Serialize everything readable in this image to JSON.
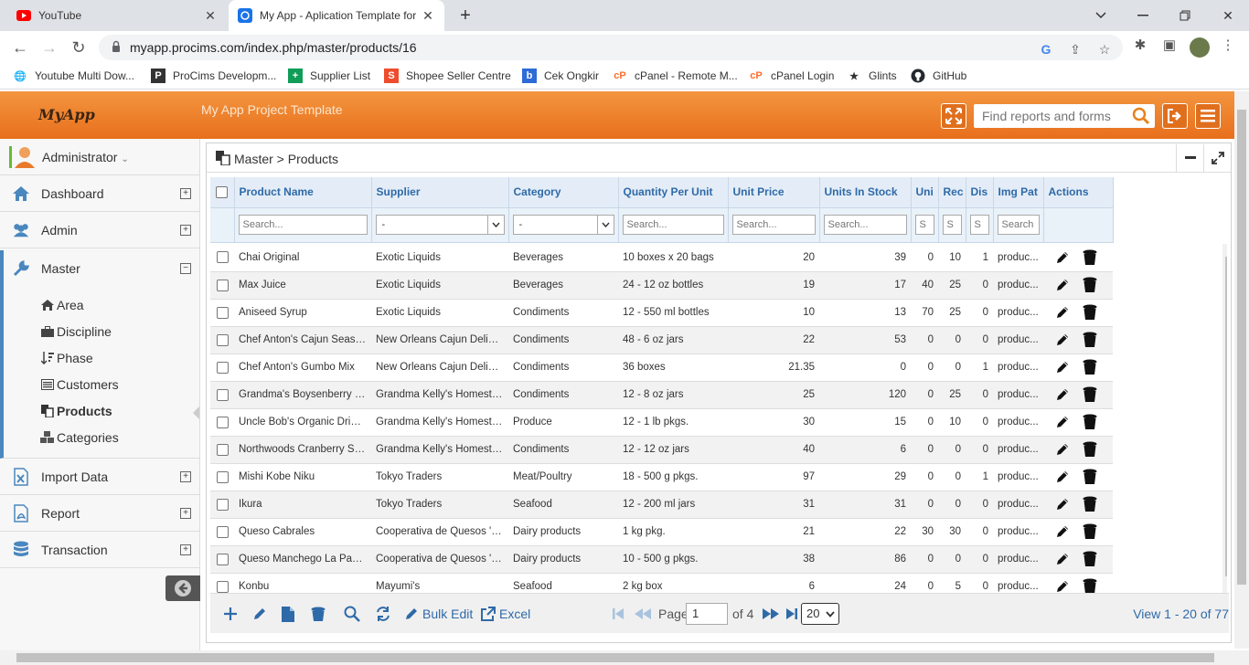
{
  "browser": {
    "tabs": [
      {
        "title": "YouTube",
        "active": false
      },
      {
        "title": "My App - Aplication Template for",
        "active": true
      }
    ],
    "url": "myapp.procims.com/index.php/master/products/16",
    "bookmarks": [
      {
        "label": "Youtube Multi Dow..."
      },
      {
        "label": "ProCims Developm..."
      },
      {
        "label": "Supplier List"
      },
      {
        "label": "Shopee Seller Centre"
      },
      {
        "label": "Cek Ongkir"
      },
      {
        "label": "cPanel - Remote M..."
      },
      {
        "label": "cPanel Login"
      },
      {
        "label": "Glints"
      },
      {
        "label": "GitHub"
      }
    ]
  },
  "header": {
    "logo": "MyApp",
    "title": "My App Project Template",
    "search_placeholder": "Find reports and forms"
  },
  "sidebar": {
    "user": "Administrator",
    "items": [
      {
        "label": "Dashboard",
        "toggle": "+"
      },
      {
        "label": "Admin",
        "toggle": "+"
      },
      {
        "label": "Master",
        "toggle": "−"
      },
      {
        "label": "Import Data",
        "toggle": "+"
      },
      {
        "label": "Report",
        "toggle": "+"
      },
      {
        "label": "Transaction",
        "toggle": "+"
      }
    ],
    "master_sub": [
      {
        "label": "Area"
      },
      {
        "label": "Discipline"
      },
      {
        "label": "Phase"
      },
      {
        "label": "Customers"
      },
      {
        "label": "Products"
      },
      {
        "label": "Categories"
      }
    ]
  },
  "panel": {
    "breadcrumb": "Master > Products"
  },
  "grid": {
    "columns": [
      "Product Name",
      "Supplier",
      "Category",
      "Quantity Per Unit",
      "Unit Price",
      "Units In Stock",
      "Uni",
      "Rec",
      "Dis",
      "Img Pat",
      "Actions"
    ],
    "filters": {
      "search": "Search...",
      "select": "-",
      "short": "S",
      "img": "Search"
    },
    "rows": [
      {
        "name": "Chai Original",
        "supplier": "Exotic Liquids",
        "category": "Beverages",
        "qpu": "10 boxes x 20 bags",
        "price": "20",
        "stock": "39",
        "uni": "0",
        "rec": "10",
        "dis": "1",
        "img": "produc..."
      },
      {
        "name": "Max Juice",
        "supplier": "Exotic Liquids",
        "category": "Beverages",
        "qpu": "24 - 12 oz bottles",
        "price": "19",
        "stock": "17",
        "uni": "40",
        "rec": "25",
        "dis": "0",
        "img": "produc..."
      },
      {
        "name": "Aniseed Syrup",
        "supplier": "Exotic Liquids",
        "category": "Condiments",
        "qpu": "12 - 550 ml bottles",
        "price": "10",
        "stock": "13",
        "uni": "70",
        "rec": "25",
        "dis": "0",
        "img": "produc..."
      },
      {
        "name": "Chef Anton's Cajun Season...",
        "supplier": "New Orleans Cajun Delights",
        "category": "Condiments",
        "qpu": "48 - 6 oz jars",
        "price": "22",
        "stock": "53",
        "uni": "0",
        "rec": "0",
        "dis": "0",
        "img": "produc..."
      },
      {
        "name": "Chef Anton's Gumbo Mix",
        "supplier": "New Orleans Cajun Delights",
        "category": "Condiments",
        "qpu": "36 boxes",
        "price": "21.35",
        "stock": "0",
        "uni": "0",
        "rec": "0",
        "dis": "1",
        "img": "produc..."
      },
      {
        "name": "Grandma's Boysenberry Sp...",
        "supplier": "Grandma Kelly's Homestead",
        "category": "Condiments",
        "qpu": "12 - 8 oz jars",
        "price": "25",
        "stock": "120",
        "uni": "0",
        "rec": "25",
        "dis": "0",
        "img": "produc..."
      },
      {
        "name": "Uncle Bob's Organic Dried ...",
        "supplier": "Grandma Kelly's Homestead",
        "category": "Produce",
        "qpu": "12 - 1 lb pkgs.",
        "price": "30",
        "stock": "15",
        "uni": "0",
        "rec": "10",
        "dis": "0",
        "img": "produc..."
      },
      {
        "name": "Northwoods Cranberry Sau...",
        "supplier": "Grandma Kelly's Homestead",
        "category": "Condiments",
        "qpu": "12 - 12 oz jars",
        "price": "40",
        "stock": "6",
        "uni": "0",
        "rec": "0",
        "dis": "0",
        "img": "produc..."
      },
      {
        "name": "Mishi Kobe Niku",
        "supplier": "Tokyo Traders",
        "category": "Meat/Poultry",
        "qpu": "18 - 500 g pkgs.",
        "price": "97",
        "stock": "29",
        "uni": "0",
        "rec": "0",
        "dis": "1",
        "img": "produc..."
      },
      {
        "name": "Ikura",
        "supplier": "Tokyo Traders",
        "category": "Seafood",
        "qpu": "12 - 200 ml jars",
        "price": "31",
        "stock": "31",
        "uni": "0",
        "rec": "0",
        "dis": "0",
        "img": "produc..."
      },
      {
        "name": "Queso Cabrales",
        "supplier": "Cooperativa de Quesos 'La...",
        "category": "Dairy products",
        "qpu": "1 kg pkg.",
        "price": "21",
        "stock": "22",
        "uni": "30",
        "rec": "30",
        "dis": "0",
        "img": "produc..."
      },
      {
        "name": "Queso Manchego La Pastora",
        "supplier": "Cooperativa de Quesos 'La...",
        "category": "Dairy products",
        "qpu": "10 - 500 g pkgs.",
        "price": "38",
        "stock": "86",
        "uni": "0",
        "rec": "0",
        "dis": "0",
        "img": "produc..."
      },
      {
        "name": "Konbu",
        "supplier": "Mayumi's",
        "category": "Seafood",
        "qpu": "2 kg box",
        "price": "6",
        "stock": "24",
        "uni": "0",
        "rec": "5",
        "dis": "0",
        "img": "produc..."
      }
    ]
  },
  "pager": {
    "bulk_edit": "Bulk Edit",
    "excel": "Excel",
    "page_label": "Page",
    "page_value": "1",
    "of_label": "of 4",
    "page_size": "20",
    "view_text": "View 1 - 20 of 77"
  },
  "colors": {
    "header_orange": "#ee7f2b",
    "accent_blue": "#2f6aa8"
  }
}
